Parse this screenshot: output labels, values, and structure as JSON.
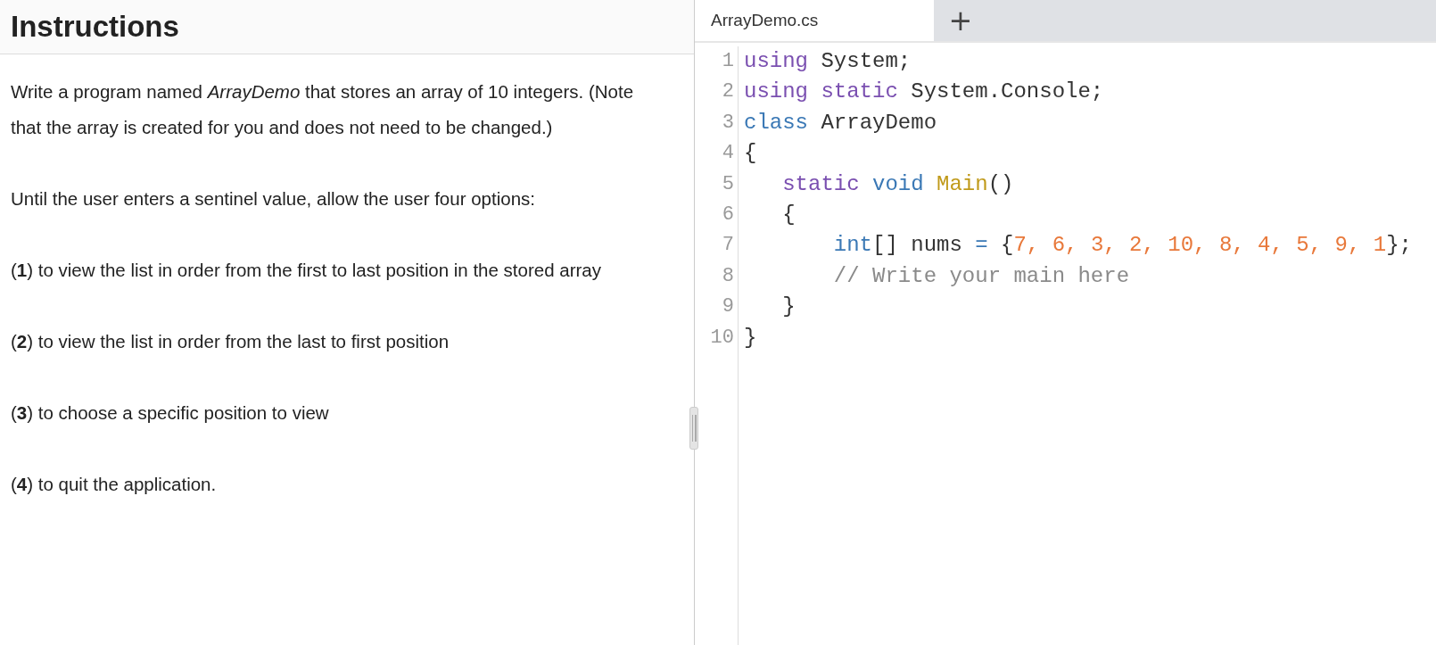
{
  "instructions": {
    "title": "Instructions",
    "paragraphs": [
      "Write a program named *ArrayDemo* that stores an array of 10 integers. (Note that the array is created for you and does not need to be changed.)",
      "Until the user enters a sentinel value, allow the user four options:",
      "(**1**) to view the list in order from the first to last position in the stored array",
      "(**2**) to view the list in order from the last to first position",
      "(**3**) to choose a specific position to view",
      "(**4**) to quit the application."
    ]
  },
  "editor": {
    "tabs": [
      {
        "label": "ArrayDemo.cs",
        "selected": true
      }
    ],
    "add_tab": "+",
    "lines": [
      {
        "number": "1",
        "tokens": [
          {
            "kind": "keyword",
            "text": "using"
          },
          {
            "kind": "plain",
            "text": " System;"
          }
        ]
      },
      {
        "number": "2",
        "tokens": [
          {
            "kind": "keyword",
            "text": "using static"
          },
          {
            "kind": "plain",
            "text": " System.Console;"
          }
        ]
      },
      {
        "number": "3",
        "tokens": [
          {
            "kind": "type",
            "text": "class"
          },
          {
            "kind": "plain",
            "text": " ArrayDemo"
          }
        ]
      },
      {
        "number": "4",
        "tokens": [
          {
            "kind": "plain",
            "text": "{"
          }
        ]
      },
      {
        "number": "5",
        "tokens": [
          {
            "kind": "keyword",
            "text": "   static"
          },
          {
            "kind": "type",
            "text": " void"
          },
          {
            "kind": "function",
            "text": " Main"
          },
          {
            "kind": "plain",
            "text": "()"
          }
        ]
      },
      {
        "number": "6",
        "tokens": [
          {
            "kind": "plain",
            "text": "   {"
          }
        ]
      },
      {
        "number": "7",
        "tokens": [
          {
            "kind": "type",
            "text": "       int"
          },
          {
            "kind": "plain",
            "text": "[] nums "
          },
          {
            "kind": "type",
            "text": "="
          },
          {
            "kind": "plain",
            "text": " {"
          },
          {
            "kind": "number",
            "text": "7, 6, 3, 2, 10, 8, 4, 5, 9, 1"
          },
          {
            "kind": "plain",
            "text": "};"
          }
        ]
      },
      {
        "number": "8",
        "tokens": [
          {
            "kind": "comment",
            "text": "       // Write your main here"
          }
        ]
      },
      {
        "number": "9",
        "tokens": [
          {
            "kind": "plain",
            "text": "   }"
          }
        ]
      },
      {
        "number": "10",
        "tokens": [
          {
            "kind": "plain",
            "text": "}"
          }
        ]
      }
    ]
  }
}
